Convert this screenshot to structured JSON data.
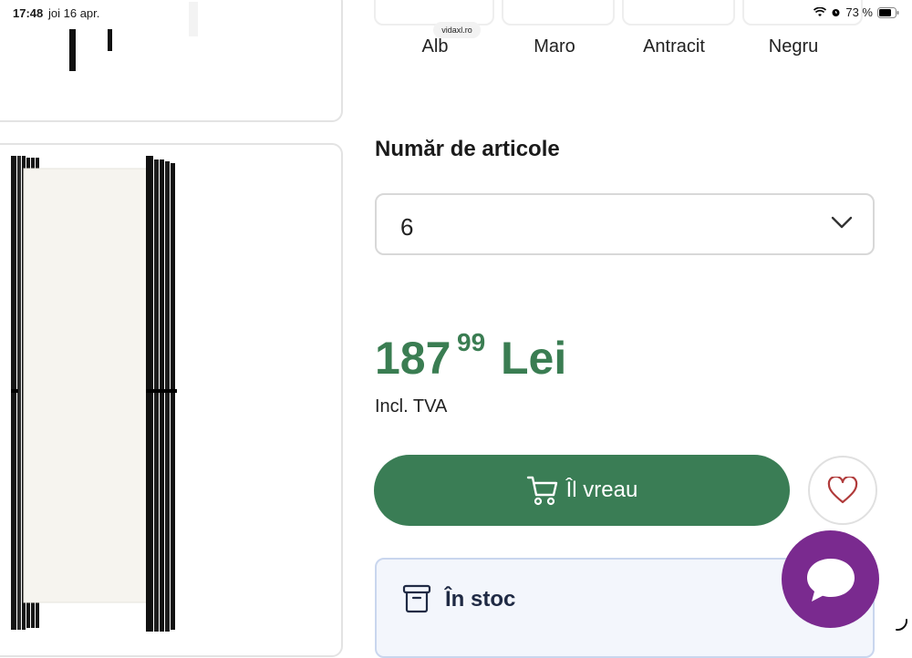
{
  "status_bar": {
    "time": "17:48",
    "date": "joi 16 apr.",
    "battery": "73 %",
    "url": "vidaxl.ro"
  },
  "colors": {
    "options": [
      {
        "label": "Alb"
      },
      {
        "label": "Maro"
      },
      {
        "label": "Antracit"
      },
      {
        "label": "Negru"
      }
    ]
  },
  "quantity": {
    "title": "Număr de articole",
    "selected": "6"
  },
  "price": {
    "integer": "187",
    "decimal": "99",
    "currency": "Lei",
    "vat_note": "Incl. TVA",
    "color": "#3a7d52"
  },
  "actions": {
    "buy_label": "Îl vreau",
    "buy_color": "#3a7d55",
    "wishlist_icon": "heart-icon"
  },
  "stock": {
    "label": "În stoc"
  },
  "chat": {
    "icon": "chat-bubble-icon",
    "color": "#7a2a8f"
  }
}
